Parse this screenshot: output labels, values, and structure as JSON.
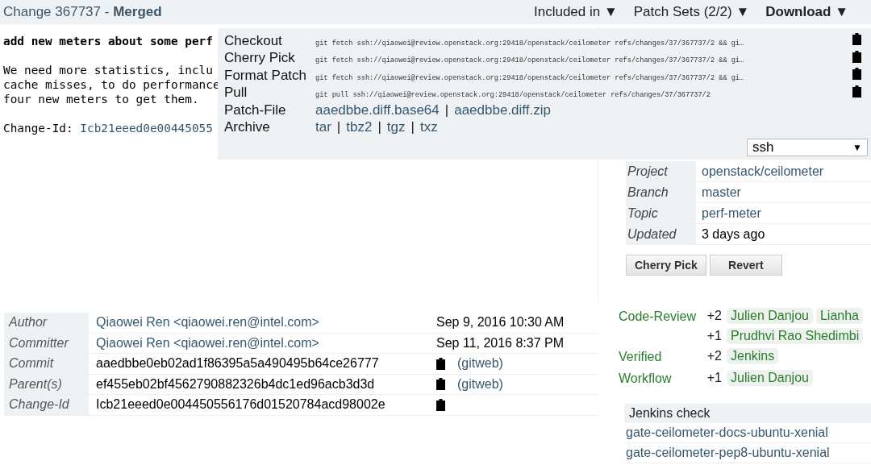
{
  "header": {
    "title": "Change 367737",
    "separator": "-",
    "status": "Merged",
    "menus": [
      {
        "label": "Included in",
        "arrow": "▼",
        "selected": false
      },
      {
        "label": "Patch Sets (2/2)",
        "arrow": "▼",
        "selected": false
      },
      {
        "label": "Download",
        "arrow": "▼",
        "selected": true
      }
    ]
  },
  "commit_message": {
    "subject": "add new meters about some perf",
    "body": [
      "We need more statistics, inclu",
      "cache misses, to do performance",
      "four new meters to get them."
    ],
    "change_id_label": "Change-Id:",
    "change_id": "Icb21eeed0e00445055"
  },
  "download": {
    "commands": [
      {
        "label": "Checkout",
        "command": "git fetch ssh://qiaowei@review.openstack.org:29418/openstack/ceilometer refs/changes/37/367737/2 && gi…"
      },
      {
        "label": "Cherry Pick",
        "command": "git fetch ssh://qiaowei@review.openstack.org:29418/openstack/ceilometer refs/changes/37/367737/2 && gi…"
      },
      {
        "label": "Format Patch",
        "command": "git fetch ssh://qiaowei@review.openstack.org:29418/openstack/ceilometer refs/changes/37/367737/2 && gi…"
      },
      {
        "label": "Pull",
        "command": "git pull ssh://qiaowei@review.openstack.org:29418/openstack/ceilometer refs/changes/37/367737/2"
      }
    ],
    "links": [
      {
        "label": "Patch-File",
        "items": [
          "aaedbbe.diff.base64",
          "aaedbbe.diff.zip"
        ]
      },
      {
        "label": "Archive",
        "items": [
          "tar",
          "tbz2",
          "tgz",
          "txz"
        ]
      }
    ],
    "separator": "|",
    "scheme": {
      "value": "ssh",
      "arrow": "▼"
    }
  },
  "info": [
    {
      "label": "Project",
      "value": "openstack/ceilometer",
      "kind": "link"
    },
    {
      "label": "Branch",
      "value": "master",
      "kind": "link"
    },
    {
      "label": "Topic",
      "value": "perf-meter",
      "kind": "link"
    },
    {
      "label": "Updated",
      "value": "3 days ago",
      "kind": "text"
    }
  ],
  "actions": [
    "Cherry Pick",
    "Revert"
  ],
  "commit_info": [
    {
      "label": "Author",
      "kind": "person",
      "value": "Qiaowei Ren <qiaowei.ren@intel.com>",
      "date": "Sep 9, 2016 10:30 AM"
    },
    {
      "label": "Committer",
      "kind": "person",
      "value": "Qiaowei Ren <qiaowei.ren@intel.com>",
      "date": "Sep 11, 2016 8:37 PM"
    },
    {
      "label": "Commit",
      "kind": "hash",
      "value": "aaedbbe0eb02ad1f86395a5a490495b64ce26777",
      "link": "(gitweb)"
    },
    {
      "label": "Parent(s)",
      "kind": "hash",
      "value": "ef455eb02bf4562790882326b4dc1ed96acb3d3d",
      "link": "(gitweb)"
    },
    {
      "label": "Change-Id",
      "kind": "hash",
      "value": "Icb21eeed0e004450556176d01520784acd98002e"
    }
  ],
  "labels": [
    {
      "name": "Code-Review",
      "votes": [
        {
          "score": "+2",
          "voters": [
            "Julien Danjou",
            "Lianha"
          ]
        },
        {
          "score": "+1",
          "voters": [
            "Prudhvi Rao Shedimbi"
          ]
        }
      ]
    },
    {
      "name": "Verified",
      "votes": [
        {
          "score": "+2",
          "voters": [
            "Jenkins"
          ]
        }
      ]
    },
    {
      "name": "Workflow",
      "votes": [
        {
          "score": "+1",
          "voters": [
            "Julien Danjou"
          ]
        }
      ]
    }
  ],
  "jenkins": {
    "title": "Jenkins check",
    "jobs": [
      "gate-ceilometer-docs-ubuntu-xenial",
      "gate-ceilometer-pep8-ubuntu-xenial"
    ]
  }
}
